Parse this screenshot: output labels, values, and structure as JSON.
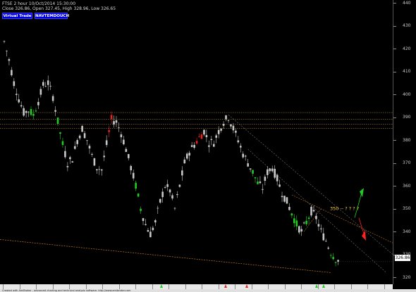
{
  "header": {
    "line1": "FTSE  2 hour  10/Oct/2014 15:30:00",
    "line2": "Close 326.86, Open 327.45, High 328.96, Low 326.65"
  },
  "buttons": {
    "virtual_trade": "Virtual Trade",
    "navtemdouch": "NAVTEMDOUCH"
  },
  "axis": {
    "y_ticks": [
      "440",
      "430",
      "420",
      "410",
      "400",
      "390",
      "380",
      "370",
      "360",
      "350",
      "340",
      "330",
      "320"
    ],
    "price_badge": "326.86"
  },
  "annotation": {
    "label": "350 -- ? ? ? ?",
    "up_arrow_color": "#22cc22",
    "down_arrow_color": "#ff2222"
  },
  "footer": {
    "text": "Created with AmiBroker - advanced charting and technical analysis software. http://www.amibroker.com"
  },
  "colors": {
    "background": "#000000",
    "candle_default": "#c8c8c8",
    "candle_green": "#22cc22",
    "candle_red": "#ee2222",
    "resistance_line": "#d8a040",
    "trend_line": "#c07828"
  },
  "chart_data": {
    "type": "candlestick",
    "ylim": [
      320,
      440
    ],
    "trend_path_values": [
      [
        0,
        423
      ],
      [
        4,
        415
      ],
      [
        8,
        405
      ],
      [
        12,
        398
      ],
      [
        16,
        392
      ],
      [
        20,
        393
      ],
      [
        24,
        391
      ],
      [
        28,
        397
      ],
      [
        32,
        404
      ],
      [
        36,
        405
      ],
      [
        40,
        399
      ],
      [
        44,
        388
      ],
      [
        48,
        378
      ],
      [
        52,
        370
      ],
      [
        56,
        372
      ],
      [
        60,
        380
      ],
      [
        64,
        385
      ],
      [
        68,
        380
      ],
      [
        72,
        373
      ],
      [
        76,
        368
      ],
      [
        80,
        367
      ],
      [
        84,
        378
      ],
      [
        88,
        389
      ],
      [
        92,
        388
      ],
      [
        96,
        383
      ],
      [
        100,
        376
      ],
      [
        104,
        368
      ],
      [
        108,
        360
      ],
      [
        112,
        350
      ],
      [
        116,
        343
      ],
      [
        120,
        339
      ],
      [
        124,
        344
      ],
      [
        128,
        353
      ],
      [
        132,
        360
      ],
      [
        136,
        358
      ],
      [
        140,
        350
      ],
      [
        144,
        360
      ],
      [
        148,
        370
      ],
      [
        152,
        375
      ],
      [
        156,
        378
      ],
      [
        160,
        381
      ],
      [
        164,
        384
      ],
      [
        168,
        379
      ],
      [
        172,
        379
      ],
      [
        176,
        384
      ],
      [
        180,
        388
      ],
      [
        184,
        390
      ],
      [
        188,
        385
      ],
      [
        192,
        380
      ],
      [
        196,
        374
      ],
      [
        200,
        370
      ],
      [
        204,
        366
      ],
      [
        208,
        361
      ],
      [
        212,
        359
      ],
      [
        216,
        366
      ],
      [
        220,
        368
      ],
      [
        224,
        363
      ],
      [
        228,
        357
      ],
      [
        232,
        353
      ],
      [
        236,
        348
      ],
      [
        240,
        343
      ],
      [
        244,
        340
      ],
      [
        248,
        344
      ],
      [
        252,
        349
      ],
      [
        256,
        346
      ],
      [
        260,
        340
      ],
      [
        264,
        336
      ],
      [
        268,
        331
      ],
      [
        272,
        328
      ],
      [
        276,
        327
      ]
    ],
    "green_segments": [
      [
        22,
        26
      ],
      [
        44,
        48
      ],
      [
        108,
        113
      ],
      [
        204,
        208
      ],
      [
        236,
        240
      ],
      [
        248,
        250
      ],
      [
        268,
        272
      ]
    ],
    "red_segments": [
      [
        85,
        88
      ],
      [
        158,
        163
      ]
    ],
    "resistance_levels": [
      392,
      389,
      387,
      385
    ],
    "annotation_level": 350
  }
}
